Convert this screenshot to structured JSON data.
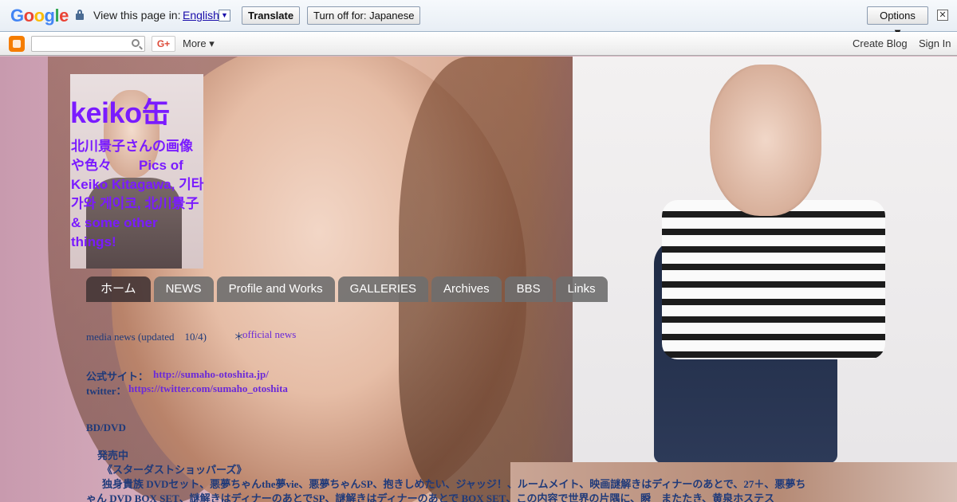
{
  "translate_bar": {
    "logo_letters": [
      "G",
      "o",
      "o",
      "g",
      "l",
      "e"
    ],
    "logo_colors": [
      "#4285f4",
      "#ea4335",
      "#fbbc05",
      "#4285f4",
      "#34a853",
      "#ea4335"
    ],
    "prompt": "View this page in:",
    "language": "English",
    "translate_label": "Translate",
    "turn_off_label": "Turn off for: Japanese",
    "options_label": "Options ▼",
    "close_glyph": "✕"
  },
  "navbar": {
    "search_placeholder": "",
    "gplus_label": "G+",
    "more_label": "More ▾",
    "create_blog_label": "Create Blog",
    "sign_in_label": "Sign In"
  },
  "header": {
    "title": "keiko缶",
    "description": "北川景子さんの画像や色々　　Pics of Keiko Kitagawa, 기타가와 게이코, 北川景子 & some other things!"
  },
  "tabs": [
    {
      "label": "ホーム",
      "active": true
    },
    {
      "label": "NEWS",
      "active": false
    },
    {
      "label": "Profile and Works",
      "active": false
    },
    {
      "label": "GALLERIES",
      "active": false
    },
    {
      "label": "Archives",
      "active": false
    },
    {
      "label": "BBS",
      "active": false
    },
    {
      "label": "Links",
      "active": false
    }
  ],
  "content": {
    "media_info": "media news (updated　10/4)",
    "official_news_prefix": "＊",
    "official_news_link": "official news",
    "site_label": "公式サイト：",
    "site_url": "http://sumaho-otoshita.jp/",
    "twitter_label": "twitter：",
    "twitter_url": "https://twitter.com/sumaho_otoshita",
    "bd_heading": "BD/DVD",
    "release_label": "発売中",
    "release_title": "《スターダストショッパーズ》",
    "release_line1": "独身貴族 DVDセット、悪夢ちゃんthe夢vie、悪夢ちゃんSP、抱きしめたい、ジャッジ！、ルームメイト、映画謎解きはディナーのあとで、27＋、悪夢ち",
    "release_line2": "ゃん DVD BOX SET、謎解きはディナーのあとでSP、謎解きはディナーのあとで BOX SET、この内容で世界の片隅に、瞬　またたき、黄泉ホステス"
  }
}
